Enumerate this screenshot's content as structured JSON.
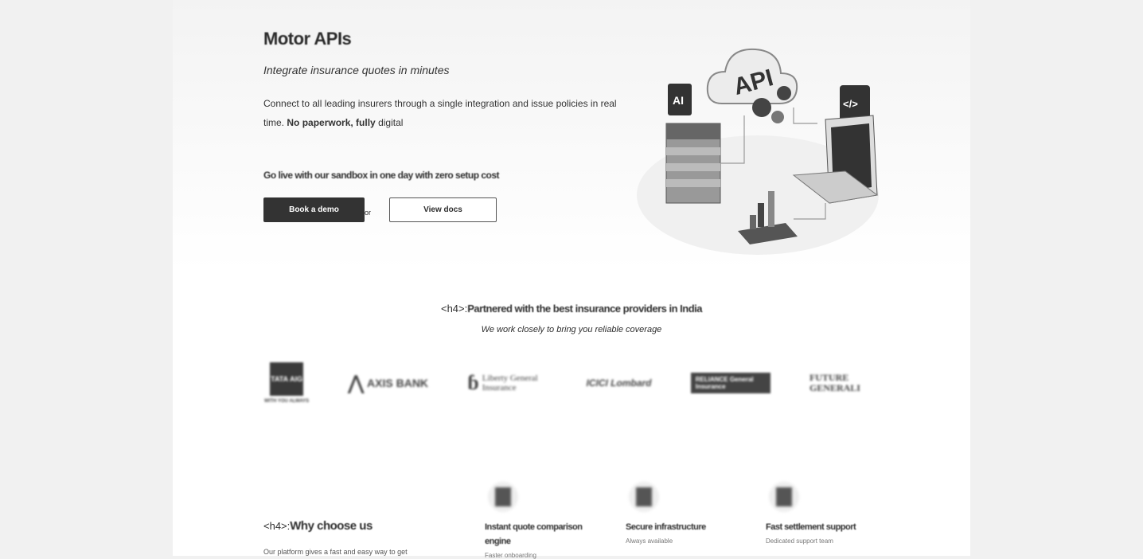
{
  "hero": {
    "title": "Motor APIs",
    "subtitle": "Integrate insurance quotes in minutes",
    "description_plain": "Connect to all leading insurers through a single integration and issue policies in real time.",
    "description_bold": "No paperwork, fully",
    "description_end": "digital",
    "note": "Go live with our sandbox in one day with zero setup cost",
    "primary_button": "Book a demo",
    "or_label": "or",
    "secondary_button": "View docs"
  },
  "partners": {
    "tag": "<h4>:",
    "title": "Partnered with the best insurance providers in India",
    "subtitle": "We work closely to bring you reliable coverage",
    "logos": [
      "TATA AIG",
      "AXIS BANK",
      "Liberty General Insurance",
      "ICICI Lombard",
      "RELIANCE General Insurance",
      "FUTURE GENERALI"
    ],
    "tata_tagline": "WITH YOU ALWAYS"
  },
  "why": {
    "tag": "<h4>:",
    "title": "Why choose us",
    "text": "Our platform gives a fast and easy way to get"
  },
  "features": [
    {
      "title": "Instant quote comparison engine",
      "desc": "Faster onboarding"
    },
    {
      "title": "Secure infrastructure",
      "desc": "Always available"
    },
    {
      "title": "Fast settlement support",
      "desc": "Dedicated support team"
    }
  ],
  "illustration": {
    "cloud_label": "API",
    "ai_label": "AI",
    "code_label": "</>"
  }
}
